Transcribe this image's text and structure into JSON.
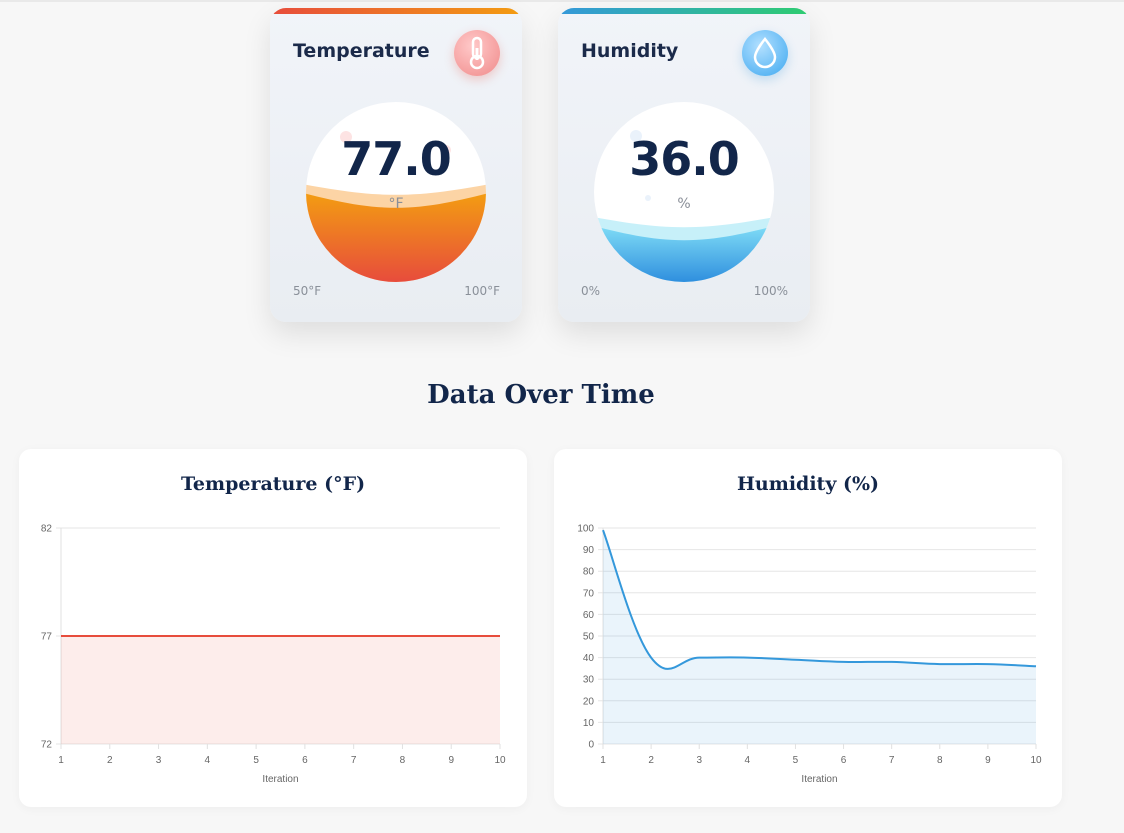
{
  "temperature_card": {
    "title": "Temperature",
    "value": "77.0",
    "unit": "°F",
    "range_min": "50°F",
    "range_max": "100°F",
    "fill_fraction": 0.54,
    "icon": "thermometer-icon",
    "accent_start": "#e74c3c",
    "accent_end": "#f39c12"
  },
  "humidity_card": {
    "title": "Humidity",
    "value": "36.0",
    "unit": "%",
    "range_min": "0%",
    "range_max": "100%",
    "fill_fraction": 0.36,
    "icon": "water-drop-icon",
    "accent_start": "#3498db",
    "accent_end": "#2ecc71"
  },
  "section_title": "Data Over Time",
  "chart_data": [
    {
      "type": "area",
      "title": "Temperature (°F)",
      "xlabel": "Iteration",
      "ylabel": "",
      "x": [
        1,
        2,
        3,
        4,
        5,
        6,
        7,
        8,
        9,
        10
      ],
      "series": [
        {
          "values": [
            77,
            77,
            77,
            77,
            77,
            77,
            77,
            77,
            77,
            77
          ],
          "color": "#e74c3c"
        }
      ],
      "xlim": [
        1,
        10
      ],
      "ylim": [
        72,
        82
      ],
      "yticks": [
        72,
        77,
        82
      ],
      "grid": true,
      "legend": "none"
    },
    {
      "type": "area",
      "title": "Humidity (%)",
      "xlabel": "Iteration",
      "ylabel": "",
      "x": [
        1,
        2,
        3,
        4,
        5,
        6,
        7,
        8,
        9,
        10
      ],
      "series": [
        {
          "values": [
            99,
            40,
            40,
            40,
            39,
            38,
            38,
            37,
            37,
            36
          ],
          "color": "#3498db"
        }
      ],
      "xlim": [
        1,
        10
      ],
      "ylim": [
        0,
        100
      ],
      "yticks": [
        0,
        10,
        20,
        30,
        40,
        50,
        60,
        70,
        80,
        90,
        100
      ],
      "grid": true,
      "legend": "none"
    }
  ]
}
